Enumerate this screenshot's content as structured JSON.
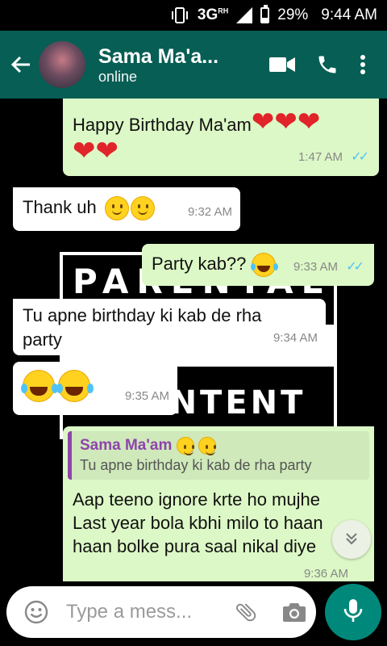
{
  "status_bar": {
    "network": "3G",
    "network_sup": "RH",
    "battery": "29%",
    "time": "9:44 AM"
  },
  "header": {
    "contact_name": "Sama Ma'a...",
    "status": "online"
  },
  "wallpaper": {
    "line1": "PARENTAL",
    "line3": "T CONTENT"
  },
  "messages": [
    {
      "direction": "out",
      "text": "Happy Birthday Ma'am",
      "emoji": "❤️❤️❤️❤️❤️",
      "time": "1:47 AM",
      "read": true
    },
    {
      "direction": "in",
      "text": "Thank uh",
      "time": "9:32 AM"
    },
    {
      "direction": "out",
      "text": "Party kab??",
      "time": "9:33 AM",
      "read": true
    },
    {
      "direction": "in",
      "text": "Tu apne birthday ki kab de rha party",
      "time": "9:34 AM"
    },
    {
      "direction": "in",
      "text": "😂😂",
      "time": "9:35 AM"
    },
    {
      "direction": "out",
      "quote": {
        "name": "Sama Ma'am",
        "text": "Tu apne birthday ki kab de rha party"
      },
      "lines": [
        "Aap teeno ignore krte ho mujhe",
        "Last year bola kbhi milo to haan",
        "haan bolke pura saal nikal diye"
      ],
      "time": "9:36 AM"
    }
  ],
  "input": {
    "placeholder": "Type a mess..."
  },
  "colors": {
    "header": "#075E54",
    "outgoing_bubble": "#DCF8C6",
    "incoming_bubble": "#FFFFFF",
    "mic_button": "#00897B",
    "read_ticks": "#4FC3F7"
  },
  "icons": [
    "vibrate-icon",
    "signal-icon",
    "battery-icon",
    "back-arrow-icon",
    "video-call-icon",
    "phone-icon",
    "more-vert-icon",
    "emoji-icon",
    "attach-icon",
    "camera-icon",
    "mic-icon",
    "chevron-down-icon"
  ]
}
